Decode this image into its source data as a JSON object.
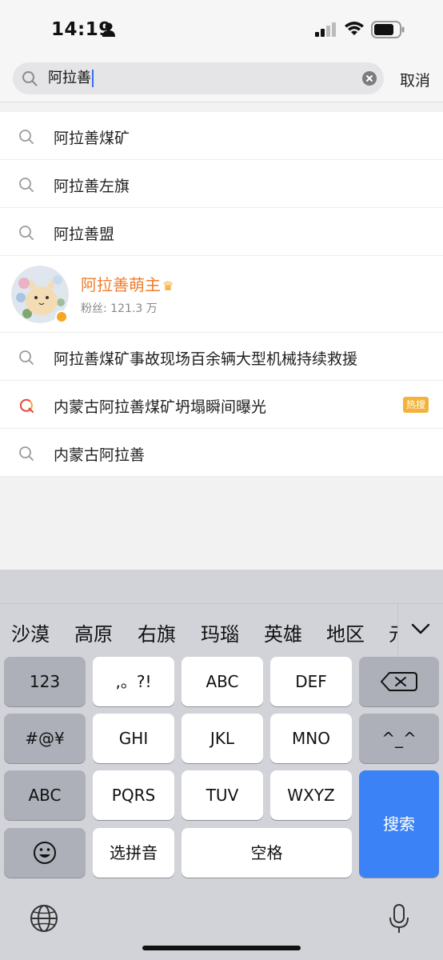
{
  "status_bar": {
    "time": "14:19"
  },
  "search": {
    "query": "阿拉善",
    "cancel_label": "取消"
  },
  "suggestions": [
    {
      "text": "阿拉善煤矿"
    },
    {
      "text": "阿拉善左旗"
    },
    {
      "text": "阿拉善盟"
    }
  ],
  "user_result": {
    "name": "阿拉善萌主",
    "fans": "粉丝: 121.3 万",
    "crown_icon": "crown-icon"
  },
  "suggestions_2": [
    {
      "text": "阿拉善煤矿事故现场百余辆大型机械持续救援"
    },
    {
      "text": "内蒙古阿拉善煤矿坍塌瞬间曝光",
      "badge": "热搜"
    },
    {
      "text": "内蒙古阿拉善"
    }
  ],
  "keyboard": {
    "candidates": [
      "沙漠",
      "高原",
      "右旗",
      "玛瑙",
      "英雄",
      "地区",
      "元"
    ],
    "keys": {
      "k123": "123",
      "punct": ",。?!",
      "abc": "ABC",
      "def": "DEF",
      "hash": "#@¥",
      "ghi": "GHI",
      "jkl": "JKL",
      "mno": "MNO",
      "emoticon": "^_^",
      "abc_mode": "ABC",
      "pqrs": "PQRS",
      "tuv": "TUV",
      "wxyz": "WXYZ",
      "search": "搜索",
      "pinyin": "选拼音",
      "space": "空格"
    }
  },
  "colors": {
    "accent": "#3b82f6",
    "username": "#f07c2b",
    "hot_badge": "#f2b33a"
  }
}
